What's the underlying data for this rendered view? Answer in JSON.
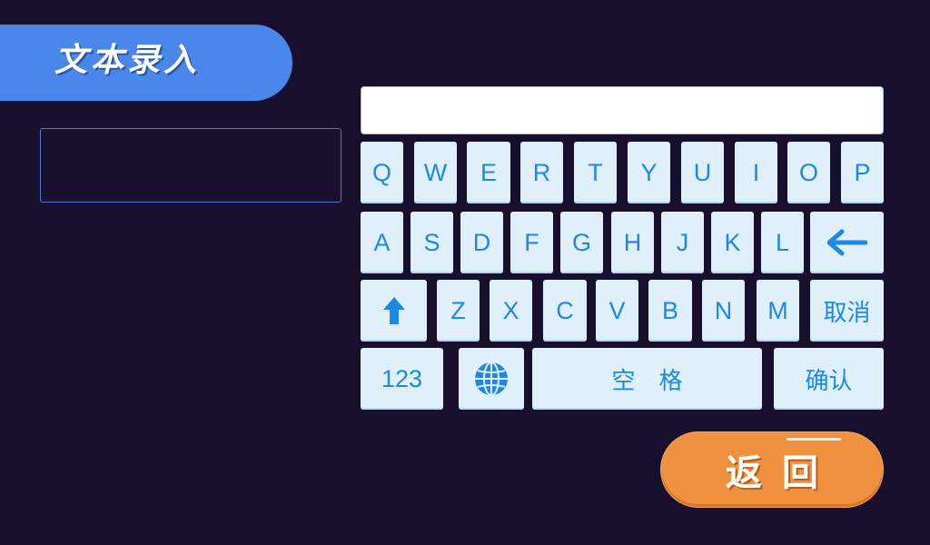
{
  "header": {
    "title": "文本录入"
  },
  "text_input": {
    "value": ""
  },
  "keyboard": {
    "display_value": "",
    "row1": [
      "Q",
      "W",
      "E",
      "R",
      "T",
      "Y",
      "U",
      "I",
      "O",
      "P"
    ],
    "row2": [
      "A",
      "S",
      "D",
      "F",
      "G",
      "H",
      "J",
      "K",
      "L"
    ],
    "row3": [
      "Z",
      "X",
      "C",
      "V",
      "B",
      "N",
      "M"
    ],
    "cancel_label": "取消",
    "numbers_label": "123",
    "space_label": "空　格",
    "confirm_label": "确认",
    "icons": {
      "backspace": "left-arrow-icon",
      "shift": "up-arrow-icon",
      "language": "globe-icon"
    }
  },
  "footer": {
    "back_label": "返回"
  },
  "colors": {
    "background": "#170f2b",
    "title_tab": "#4a87ea",
    "key_bg": "#dff0fb",
    "key_text": "#1e88e5",
    "back_button": "#f0913f"
  }
}
